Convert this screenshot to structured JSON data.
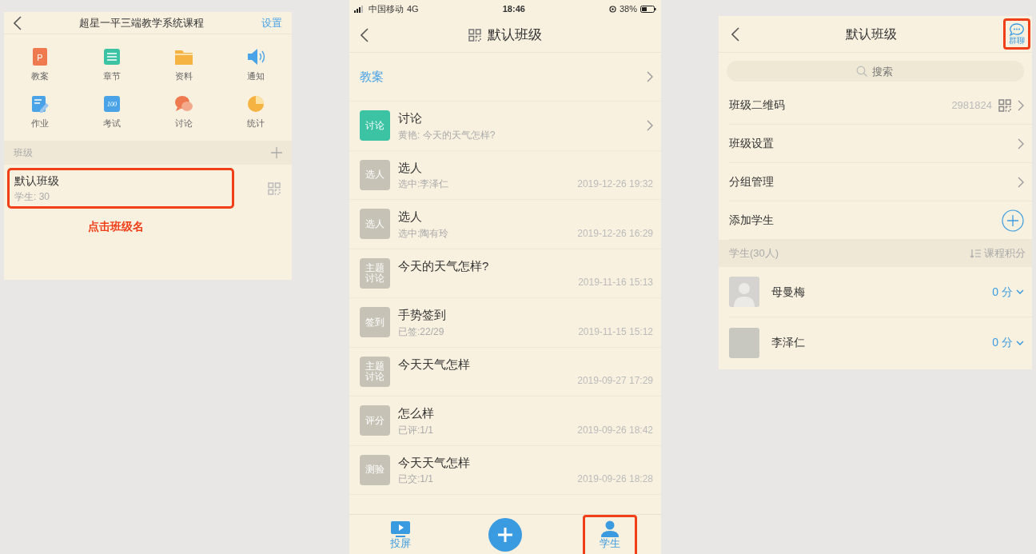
{
  "course_screen": {
    "title": "超星一平三端教学系统课程",
    "action": "设置",
    "tools": [
      {
        "label": "教案",
        "kind": "slides",
        "color": "#ef7a4f",
        "icon_text": "P"
      },
      {
        "label": "章节",
        "kind": "list",
        "color": "#3cc3a4"
      },
      {
        "label": "资料",
        "kind": "folder",
        "color": "#f5b342"
      },
      {
        "label": "通知",
        "kind": "speaker",
        "color": "#4aa3e6"
      },
      {
        "label": "作业",
        "kind": "pencil",
        "color": "#4aa3e6"
      },
      {
        "label": "考试",
        "kind": "exam",
        "color": "#4aa3e6",
        "icon_text": "100"
      },
      {
        "label": "讨论",
        "kind": "chat",
        "color": "#ef7a4f"
      },
      {
        "label": "统计",
        "kind": "pie",
        "color": "#f5b342"
      }
    ],
    "section": "班级",
    "classes": [
      {
        "name": "默认班级",
        "detail": "学生: 30",
        "highlighted": true
      }
    ],
    "annotation": "点击班级名"
  },
  "class_screen": {
    "status_bar": {
      "carrier": "中国移动",
      "network": "4G",
      "time": "18:46",
      "battery": "38%"
    },
    "title": "默认班级",
    "lesson_row": "教案",
    "activities": [
      {
        "badge": "讨论",
        "color": "#3cc3a4",
        "title": "讨论",
        "subtitle": "黄艳: 今天的天气怎样?",
        "arrow": true
      },
      {
        "badge": "选人",
        "color": "#c6c3b6",
        "title": "选人",
        "subtitle": "选中:李泽仁",
        "time": "2019-12-26 19:32",
        "arrow": false
      },
      {
        "badge": "选人",
        "color": "#c6c3b6",
        "title": "选人",
        "subtitle": "选中:陶有玲",
        "time": "2019-12-26 16:29",
        "arrow": false
      },
      {
        "badge": "主题讨论",
        "color": "#c6c3b6",
        "title": "今天的天气怎样?",
        "time": "2019-11-16 15:13",
        "arrow": false
      },
      {
        "badge": "签到",
        "color": "#c6c3b6",
        "title": "手势签到",
        "subtitle": "已签:22/29",
        "time": "2019-11-15 15:12",
        "arrow": false
      },
      {
        "badge": "主题讨论",
        "color": "#c6c3b6",
        "title": "今天天气怎样",
        "time": "2019-09-27 17:29",
        "arrow": false
      },
      {
        "badge": "评分",
        "color": "#c6c3b6",
        "title": "怎么样",
        "subtitle": "已评:1/1",
        "time": "2019-09-26 18:42",
        "arrow": false
      },
      {
        "badge": "测验",
        "color": "#c6c3b6",
        "title": "今天天气怎样",
        "subtitle": "已交:1/1",
        "time": "2019-09-26 18:28",
        "arrow": false
      }
    ],
    "tabs": [
      {
        "label": "投屏",
        "kind": "screen",
        "highlighted": false
      },
      {
        "label": "学生",
        "kind": "person",
        "highlighted": true
      }
    ]
  },
  "members_screen": {
    "title": "默认班级",
    "chat_action": {
      "label": "群聊",
      "highlighted": true
    },
    "search": {
      "placeholder": "搜索"
    },
    "rows": [
      {
        "label": "班级二维码",
        "value": "2981824",
        "kind": "qr"
      },
      {
        "label": "班级设置",
        "kind": "link"
      },
      {
        "label": "分组管理",
        "kind": "link"
      },
      {
        "label": "添加学生",
        "kind": "add"
      }
    ],
    "students_header": {
      "title": "学生(30人)",
      "sort": "课程积分"
    },
    "students": [
      {
        "name": "母曼梅",
        "score": "0 分",
        "kind": "default"
      },
      {
        "name": "李泽仁",
        "score": "0 分",
        "kind": "photo"
      }
    ]
  }
}
